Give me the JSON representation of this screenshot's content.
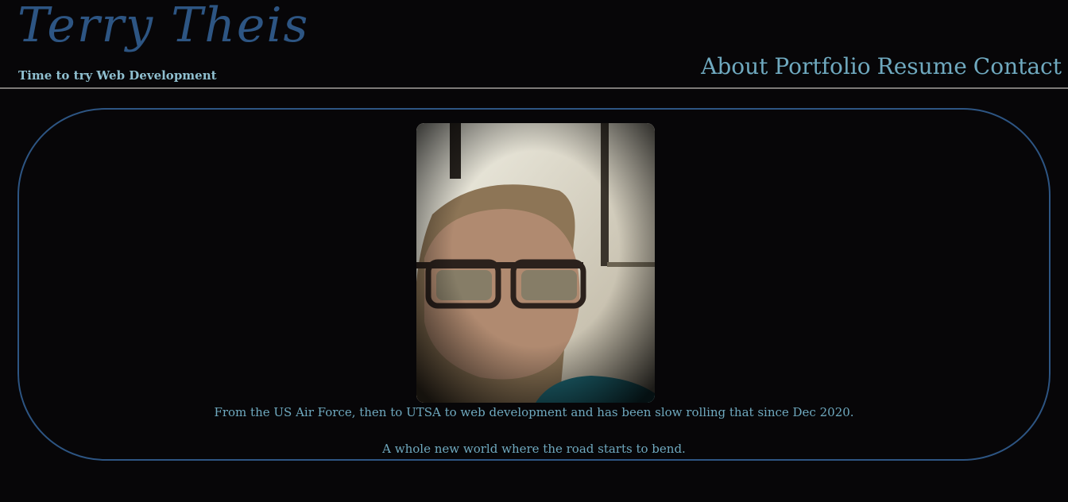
{
  "header": {
    "title": "Terry Theis",
    "tagline": "Time to try Web Development"
  },
  "nav": {
    "items": [
      {
        "label": "About"
      },
      {
        "label": "Portfolio"
      },
      {
        "label": "Resume"
      },
      {
        "label": "Contact"
      }
    ]
  },
  "main": {
    "portrait": {
      "icon": "portrait-photo"
    },
    "paragraphs": [
      "From the US Air Force, then to UTSA to web development and has been slow rolling that since Dec 2020.",
      "A whole new world where the road starts to bend."
    ]
  },
  "colors": {
    "background": "#070608",
    "title": "#2d5583",
    "accent": "#6fa9bf",
    "border": "#2d5583",
    "divider": "#7d7a78"
  }
}
